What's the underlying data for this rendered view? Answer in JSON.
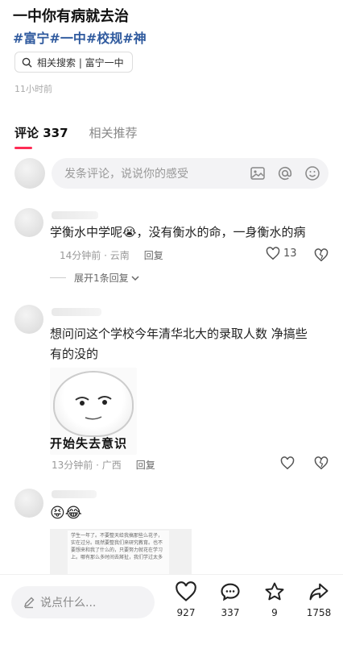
{
  "post": {
    "title": "一中你有病就去治",
    "tags": [
      "#富宁",
      "#一中",
      "#校规",
      "#神"
    ],
    "related_search": "相关搜索 | 富宁一中",
    "timestamp": "11小时前"
  },
  "tabs": [
    {
      "label": "评论 337",
      "active": true
    },
    {
      "label": "相关推荐",
      "active": false
    }
  ],
  "comment_input": {
    "placeholder": "发条评论，说说你的感受"
  },
  "comments": [
    {
      "text": "学衡水中学呢😭，没有衡水的命，一身衡水的病",
      "time_location": "14分钟前 · 云南",
      "reply_label": "回复",
      "likes": "13",
      "expand_label": "展开1条回复"
    },
    {
      "text_line1": "想问问这个学校今年清华北大的录取人数 净搞些",
      "text_line2": "有的没的",
      "meme_caption": "开始失去意识",
      "time_location": "13分钟前 · 广西",
      "reply_label": "回复"
    },
    {
      "emojis": "😝😂",
      "doc_text": "学生一年了。不要整天给我搞那些么花子，实在过分。既然要整我们来研究教育。也不要想来和我了什么的，只要努力就花在学习上。哪有那么多时间去掰扯，我们学过太多"
    }
  ],
  "bottom_bar": {
    "say_placeholder": "说点什么...",
    "likes": "927",
    "comments": "337",
    "favorites": "9",
    "shares": "1758"
  }
}
